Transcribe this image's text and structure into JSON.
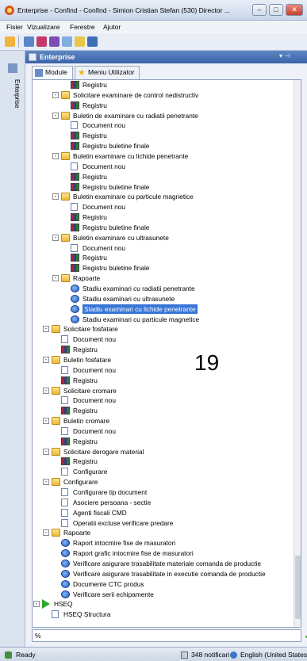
{
  "window": {
    "title": "Enterprise - Confind - Confind - Simion Cristian Stefan (530) Director ...",
    "buttons": {
      "minimize": "–",
      "maximize": "□",
      "close": "✕"
    }
  },
  "menu": [
    "Fisier",
    "Vizualizare",
    "Ferestre",
    "Ajutor"
  ],
  "sidebar": {
    "label": "Enterprise"
  },
  "panel": {
    "title": "Enterprise",
    "pin": "▾  ⊣"
  },
  "tabs": [
    {
      "label": "Module",
      "icon": "module-tree-icon"
    },
    {
      "label": "Meniu Utilizator",
      "icon": "star-icon"
    }
  ],
  "tree": [
    {
      "depth": 3,
      "icon": "books",
      "label": "Registru"
    },
    {
      "depth": 2,
      "exp": "-",
      "icon": "folder",
      "label": "Solicitare examinare de control nedistructiv"
    },
    {
      "depth": 3,
      "icon": "books",
      "label": "Registru"
    },
    {
      "depth": 2,
      "exp": "-",
      "icon": "folder",
      "label": "Buletin de examinare cu radiatii penetrante"
    },
    {
      "depth": 3,
      "icon": "doc",
      "label": "Document nou"
    },
    {
      "depth": 3,
      "icon": "books",
      "label": "Registru"
    },
    {
      "depth": 3,
      "icon": "books",
      "label": "Registru buletine finale"
    },
    {
      "depth": 2,
      "exp": "-",
      "icon": "folder",
      "label": "Buletin examinare cu lichide penetrante"
    },
    {
      "depth": 3,
      "icon": "doc",
      "label": "Document nou"
    },
    {
      "depth": 3,
      "icon": "books",
      "label": "Registru"
    },
    {
      "depth": 3,
      "icon": "books",
      "label": "Registru buletine finale"
    },
    {
      "depth": 2,
      "exp": "-",
      "icon": "folder",
      "label": "Buletin examinare cu particule magnetice"
    },
    {
      "depth": 3,
      "icon": "doc",
      "label": "Document nou"
    },
    {
      "depth": 3,
      "icon": "books",
      "label": "Registru"
    },
    {
      "depth": 3,
      "icon": "books",
      "label": "Registru buletine finale"
    },
    {
      "depth": 2,
      "exp": "-",
      "icon": "folder",
      "label": "Buletin examinare cu ultrasunete"
    },
    {
      "depth": 3,
      "icon": "doc",
      "label": "Document nou"
    },
    {
      "depth": 3,
      "icon": "books",
      "label": "Registru"
    },
    {
      "depth": 3,
      "icon": "books",
      "label": "Registru buletine finale"
    },
    {
      "depth": 2,
      "exp": "-",
      "icon": "folder",
      "label": "Rapoarte"
    },
    {
      "depth": 3,
      "icon": "report",
      "label": "Stadiu examinari cu radiatii penetrante"
    },
    {
      "depth": 3,
      "icon": "report",
      "label": "Stadiu examinari cu ultrasunete"
    },
    {
      "depth": 3,
      "icon": "report",
      "label": "Stadiu examinari cu lichide penetrante",
      "selected": true
    },
    {
      "depth": 3,
      "icon": "report",
      "label": "Stadiu examinari cu particule magnetice"
    },
    {
      "depth": 1,
      "exp": "-",
      "icon": "folder",
      "label": "Solicitare fosfatare"
    },
    {
      "depth": 2,
      "icon": "doc",
      "label": "Document nou"
    },
    {
      "depth": 2,
      "icon": "books",
      "label": "Registru"
    },
    {
      "depth": 1,
      "exp": "-",
      "icon": "folder",
      "label": "Buletin fosfatare"
    },
    {
      "depth": 2,
      "icon": "doc",
      "label": "Document nou"
    },
    {
      "depth": 2,
      "icon": "books",
      "label": "Registru"
    },
    {
      "depth": 1,
      "exp": "-",
      "icon": "folder",
      "label": "Solicitare cromare"
    },
    {
      "depth": 2,
      "icon": "doc",
      "label": "Document nou"
    },
    {
      "depth": 2,
      "icon": "books",
      "label": "Registru"
    },
    {
      "depth": 1,
      "exp": "-",
      "icon": "folder",
      "label": "Buletin cromare"
    },
    {
      "depth": 2,
      "icon": "doc",
      "label": "Document nou"
    },
    {
      "depth": 2,
      "icon": "books",
      "label": "Registru"
    },
    {
      "depth": 1,
      "exp": "-",
      "icon": "folder",
      "label": "Solicitare derogare material"
    },
    {
      "depth": 2,
      "icon": "books",
      "label": "Registru"
    },
    {
      "depth": 2,
      "icon": "doc",
      "label": "Configurare"
    },
    {
      "depth": 1,
      "exp": "-",
      "icon": "folder",
      "label": "Configurare"
    },
    {
      "depth": 2,
      "icon": "doc",
      "label": "Configurare tip document"
    },
    {
      "depth": 2,
      "icon": "doc",
      "label": "Asociere persoana - sectie"
    },
    {
      "depth": 2,
      "icon": "doc",
      "label": "Agenti fiscali CMD"
    },
    {
      "depth": 2,
      "icon": "doc",
      "label": "Operatii excluse verificare predare"
    },
    {
      "depth": 1,
      "exp": "-",
      "icon": "folder",
      "label": "Rapoarte"
    },
    {
      "depth": 2,
      "icon": "report",
      "label": "Raport intocmire fise de masuratori"
    },
    {
      "depth": 2,
      "icon": "report",
      "label": "Raport grafic intocmire fise de masuratori"
    },
    {
      "depth": 2,
      "icon": "report",
      "label": "Verificare asigurare trasabilitate materiale comanda de productie"
    },
    {
      "depth": 2,
      "icon": "report",
      "label": "Verificare asigurare trasabilitate in executie comanda de productie"
    },
    {
      "depth": 2,
      "icon": "report",
      "label": "Documente CTC produs"
    },
    {
      "depth": 2,
      "icon": "report",
      "label": "Verificare serii echipamente"
    },
    {
      "depth": 0,
      "exp": "-",
      "icon": "play",
      "label": "HSEQ"
    },
    {
      "depth": 1,
      "icon": "doc",
      "label": "HSEQ Structura"
    }
  ],
  "overlay": {
    "page_number": "19"
  },
  "search": {
    "value": "%",
    "placeholder": ""
  },
  "status": {
    "ready": "Ready",
    "notifications": "348 notificari",
    "language": "English (United States)"
  }
}
